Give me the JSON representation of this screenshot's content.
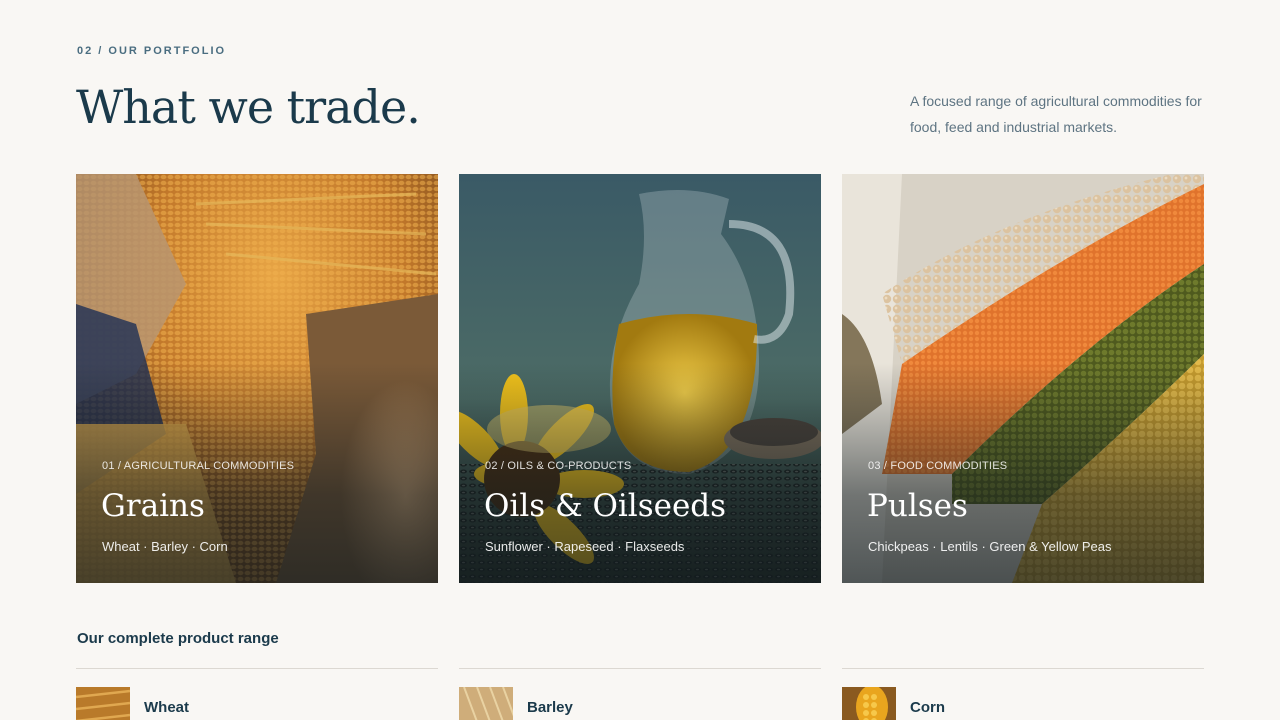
{
  "section": {
    "eyebrow": "02 / OUR PORTFOLIO",
    "headline": "What we trade.",
    "intro": "A focused range of agricultural commodities for food, feed and industrial markets."
  },
  "cards": [
    {
      "category": "01 / AGRICULTURAL COMMODITIES",
      "title": "Grains",
      "items": "Wheat · Barley · Corn",
      "image": "grain-sacks-photo"
    },
    {
      "category": "02 / OILS & CO-PRODUCTS",
      "title": "Oils & Oilseeds",
      "items": "Sunflower · Rapeseed · Flaxseeds",
      "image": "oil-jug-sunflower-photo"
    },
    {
      "category": "03 / FOOD COMMODITIES",
      "title": "Pulses",
      "items": "Chickpeas · Lentils · Green & Yellow Peas",
      "image": "pulses-stripes-photo"
    }
  ],
  "range": {
    "title": "Our complete product range",
    "items": [
      {
        "name": "Wheat",
        "image": "wheat-thumb"
      },
      {
        "name": "Barley",
        "image": "barley-thumb"
      },
      {
        "name": "Corn",
        "image": "corn-thumb"
      }
    ]
  },
  "colors": {
    "background": "#f9f7f4",
    "primary_text": "#1b3a4b",
    "muted_text": "#5e7482"
  }
}
